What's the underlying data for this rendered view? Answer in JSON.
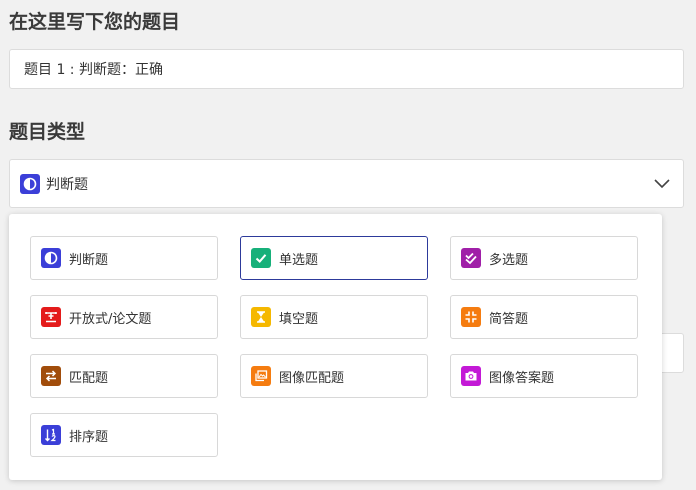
{
  "question_section": {
    "title": "在这里写下您的题目",
    "input_value": "题目 1 : 判断题：正确"
  },
  "type_section": {
    "title": "题目类型",
    "selected": {
      "label": "判断题",
      "icon": "half-circle-icon",
      "color": "#3b3fd8"
    }
  },
  "options": [
    {
      "label": "判断题",
      "icon": "half-circle-icon",
      "color": "#3b3fd8"
    },
    {
      "label": "单选题",
      "icon": "checkmark-icon",
      "color": "#17b07a"
    },
    {
      "label": "多选题",
      "icon": "double-check-icon",
      "color": "#a01fa8"
    },
    {
      "label": "开放式/论文题",
      "icon": "text-edit-icon",
      "color": "#e41b1b"
    },
    {
      "label": "填空题",
      "icon": "hourglass-icon",
      "color": "#f5b800"
    },
    {
      "label": "简答题",
      "icon": "compress-icon",
      "color": "#f57c10"
    },
    {
      "label": "匹配题",
      "icon": "swap-arrows-icon",
      "color": "#a14d0b"
    },
    {
      "label": "图像匹配题",
      "icon": "image-stack-icon",
      "color": "#f57c10"
    },
    {
      "label": "图像答案题",
      "icon": "camera-icon",
      "color": "#c319d6"
    },
    {
      "label": "排序题",
      "icon": "sort-numeric-icon",
      "color": "#3b3fd8"
    }
  ]
}
